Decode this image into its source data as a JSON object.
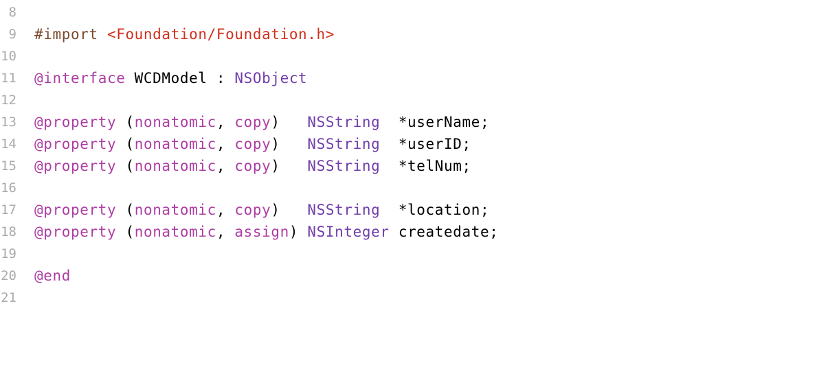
{
  "colors": {
    "preprocessor": "#78492a",
    "string": "#d12f1b",
    "keyword": "#ad3da4",
    "type": "#703daa",
    "plain": "#000000",
    "line_number": "#aaaaaa",
    "background": "#ffffff"
  },
  "lines": [
    {
      "num": "8",
      "tokens": []
    },
    {
      "num": "9",
      "tokens": [
        {
          "t": "#import",
          "k": "preproc"
        },
        {
          "t": " ",
          "k": "plain"
        },
        {
          "t": "<Foundation/Foundation.h>",
          "k": "string"
        }
      ]
    },
    {
      "num": "10",
      "tokens": []
    },
    {
      "num": "11",
      "tokens": [
        {
          "t": "@interface",
          "k": "keyword"
        },
        {
          "t": " WCDModel : ",
          "k": "plain"
        },
        {
          "t": "NSObject",
          "k": "type"
        }
      ]
    },
    {
      "num": "12",
      "tokens": []
    },
    {
      "num": "13",
      "tokens": [
        {
          "t": "@property",
          "k": "keyword"
        },
        {
          "t": " (",
          "k": "plain"
        },
        {
          "t": "nonatomic",
          "k": "keyword"
        },
        {
          "t": ", ",
          "k": "plain"
        },
        {
          "t": "copy",
          "k": "keyword"
        },
        {
          "t": ")   ",
          "k": "plain"
        },
        {
          "t": "NSString",
          "k": "type"
        },
        {
          "t": "  *userName;",
          "k": "plain"
        }
      ]
    },
    {
      "num": "14",
      "tokens": [
        {
          "t": "@property",
          "k": "keyword"
        },
        {
          "t": " (",
          "k": "plain"
        },
        {
          "t": "nonatomic",
          "k": "keyword"
        },
        {
          "t": ", ",
          "k": "plain"
        },
        {
          "t": "copy",
          "k": "keyword"
        },
        {
          "t": ")   ",
          "k": "plain"
        },
        {
          "t": "NSString",
          "k": "type"
        },
        {
          "t": "  *userID;",
          "k": "plain"
        }
      ]
    },
    {
      "num": "15",
      "tokens": [
        {
          "t": "@property",
          "k": "keyword"
        },
        {
          "t": " (",
          "k": "plain"
        },
        {
          "t": "nonatomic",
          "k": "keyword"
        },
        {
          "t": ", ",
          "k": "plain"
        },
        {
          "t": "copy",
          "k": "keyword"
        },
        {
          "t": ")   ",
          "k": "plain"
        },
        {
          "t": "NSString",
          "k": "type"
        },
        {
          "t": "  *telNum;",
          "k": "plain"
        }
      ]
    },
    {
      "num": "16",
      "tokens": []
    },
    {
      "num": "17",
      "tokens": [
        {
          "t": "@property",
          "k": "keyword"
        },
        {
          "t": " (",
          "k": "plain"
        },
        {
          "t": "nonatomic",
          "k": "keyword"
        },
        {
          "t": ", ",
          "k": "plain"
        },
        {
          "t": "copy",
          "k": "keyword"
        },
        {
          "t": ")   ",
          "k": "plain"
        },
        {
          "t": "NSString",
          "k": "type"
        },
        {
          "t": "  *location;",
          "k": "plain"
        }
      ]
    },
    {
      "num": "18",
      "tokens": [
        {
          "t": "@property",
          "k": "keyword"
        },
        {
          "t": " (",
          "k": "plain"
        },
        {
          "t": "nonatomic",
          "k": "keyword"
        },
        {
          "t": ", ",
          "k": "plain"
        },
        {
          "t": "assign",
          "k": "keyword"
        },
        {
          "t": ") ",
          "k": "plain"
        },
        {
          "t": "NSInteger",
          "k": "type"
        },
        {
          "t": " createdate;",
          "k": "plain"
        }
      ]
    },
    {
      "num": "19",
      "tokens": []
    },
    {
      "num": "20",
      "tokens": [
        {
          "t": "@end",
          "k": "keyword"
        }
      ]
    },
    {
      "num": "21",
      "tokens": []
    }
  ]
}
